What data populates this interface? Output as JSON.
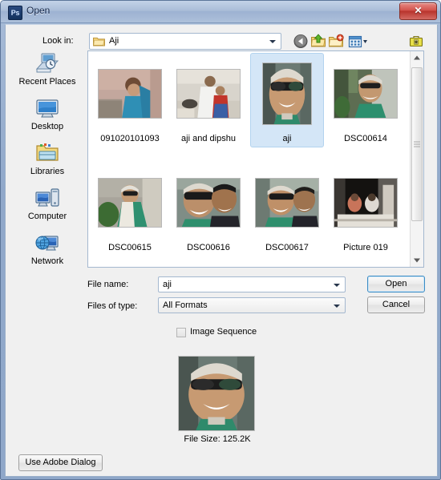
{
  "window": {
    "title": "Open",
    "app_icon": "Ps",
    "close_label": "✕"
  },
  "toolbar": {
    "lookin_label": "Look in:",
    "lookin_value": "Aji",
    "icons": [
      {
        "name": "back-icon",
        "title": "Back"
      },
      {
        "name": "up-folder-icon",
        "title": "Up One Level"
      },
      {
        "name": "new-folder-icon",
        "title": "Create New Folder"
      },
      {
        "name": "views-icon",
        "title": "Views"
      },
      {
        "name": "tools-icon",
        "title": "Tools"
      }
    ]
  },
  "places": [
    {
      "label": "Recent Places",
      "icon": "recent-places-icon"
    },
    {
      "label": "Desktop",
      "icon": "desktop-icon"
    },
    {
      "label": "Libraries",
      "icon": "libraries-icon"
    },
    {
      "label": "Computer",
      "icon": "computer-icon"
    },
    {
      "label": "Network",
      "icon": "network-icon"
    }
  ],
  "files": [
    {
      "label": "091020101093",
      "selected": false,
      "art": "a"
    },
    {
      "label": "aji and dipshu",
      "selected": false,
      "art": "b"
    },
    {
      "label": "aji",
      "selected": true,
      "art": "c"
    },
    {
      "label": "DSC00614",
      "selected": false,
      "art": "d"
    },
    {
      "label": "DSC00615",
      "selected": false,
      "art": "e"
    },
    {
      "label": "DSC00616",
      "selected": false,
      "art": "f"
    },
    {
      "label": "DSC00617",
      "selected": false,
      "art": "g"
    },
    {
      "label": "Picture 019",
      "selected": false,
      "art": "h"
    }
  ],
  "form": {
    "filename_label": "File name:",
    "filename_value": "aji",
    "filetype_label": "Files of type:",
    "filetype_value": "All Formats",
    "open_label": "Open",
    "cancel_label": "Cancel",
    "image_sequence_label": "Image Sequence",
    "image_sequence_checked": false
  },
  "preview": {
    "filesize_label": "File Size: 125.2K"
  },
  "footer": {
    "adobe_dialog_label": "Use Adobe Dialog"
  },
  "colors": {
    "accent": "#3c8cc4",
    "selection": "#d4e6f7",
    "titlebar": "#a8bcd8",
    "close": "#b8332c"
  }
}
